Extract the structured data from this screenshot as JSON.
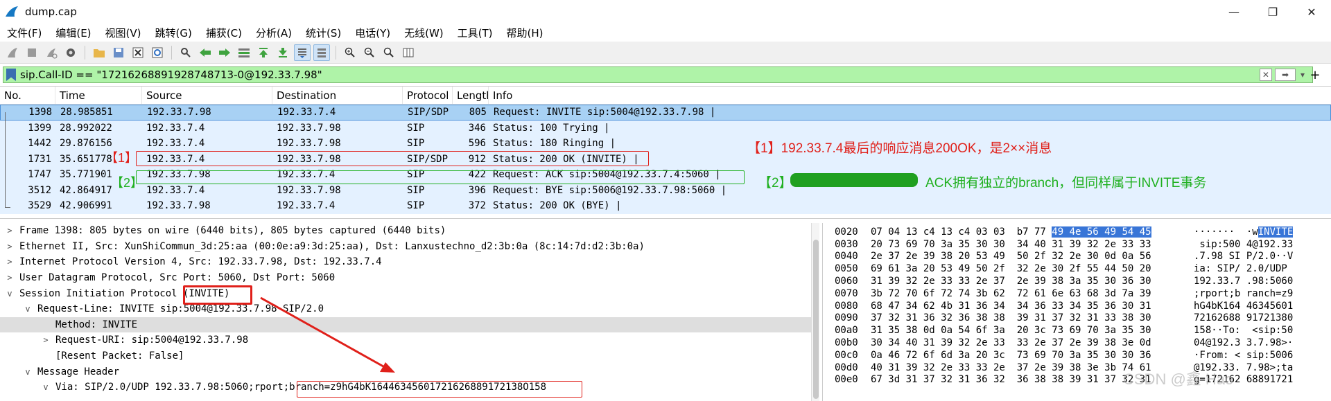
{
  "window": {
    "title": "dump.cap"
  },
  "menu": [
    "文件(F)",
    "编辑(E)",
    "视图(V)",
    "跳转(G)",
    "捕获(C)",
    "分析(A)",
    "统计(S)",
    "电话(Y)",
    "无线(W)",
    "工具(T)",
    "帮助(H)"
  ],
  "filter": {
    "value": "sip.Call-ID == \"17216268891928748713-0@192.33.7.98\""
  },
  "packet_list": {
    "columns": [
      "No.",
      "Time",
      "Source",
      "Destination",
      "Protocol",
      "Length",
      "Info"
    ],
    "rows": [
      {
        "no": "1398",
        "time": "28.985851",
        "src": "192.33.7.98",
        "dst": "192.33.7.4",
        "proto": "SIP/SDP",
        "len": "805",
        "info": "Request: INVITE sip:5004@192.33.7.98 |"
      },
      {
        "no": "1399",
        "time": "28.992022",
        "src": "192.33.7.4",
        "dst": "192.33.7.98",
        "proto": "SIP",
        "len": "346",
        "info": "Status: 100 Trying |"
      },
      {
        "no": "1442",
        "time": "29.876156",
        "src": "192.33.7.4",
        "dst": "192.33.7.98",
        "proto": "SIP",
        "len": "596",
        "info": "Status: 180 Ringing |"
      },
      {
        "no": "1731",
        "time": "35.651778",
        "src": "192.33.7.4",
        "dst": "192.33.7.98",
        "proto": "SIP/SDP",
        "len": "912",
        "info": "Status: 200 OK (INVITE) |"
      },
      {
        "no": "1747",
        "time": "35.771901",
        "src": "192.33.7.98",
        "dst": "192.33.7.4",
        "proto": "SIP",
        "len": "422",
        "info": "Request: ACK sip:5004@192.33.7.4:5060 |"
      },
      {
        "no": "3512",
        "time": "42.864917",
        "src": "192.33.7.4",
        "dst": "192.33.7.98",
        "proto": "SIP",
        "len": "396",
        "info": "Request: BYE sip:5006@192.33.7.98:5060 |"
      },
      {
        "no": "3529",
        "time": "42.906991",
        "src": "192.33.7.98",
        "dst": "192.33.7.4",
        "proto": "SIP",
        "len": "372",
        "info": "Status: 200 OK (BYE) |"
      }
    ]
  },
  "annotations": {
    "red_tag": "【1】",
    "red_note": "【1】192.33.7.4最后的响应消息200OK，是2××消息",
    "green_tag": "【2】",
    "green_note_prefix": "【2】",
    "green_note": "ACK拥有独立的branch，但同样属于INVITE事务"
  },
  "details": [
    {
      "arrow": ">",
      "indent": 0,
      "text": "Frame 1398: 805 bytes on wire (6440 bits), 805 bytes captured (6440 bits)"
    },
    {
      "arrow": ">",
      "indent": 0,
      "text": "Ethernet II, Src: XunShiCommun_3d:25:aa (00:0e:a9:3d:25:aa), Dst: Lanxustechno_d2:3b:0a (8c:14:7d:d2:3b:0a)"
    },
    {
      "arrow": ">",
      "indent": 0,
      "text": "Internet Protocol Version 4, Src: 192.33.7.98, Dst: 192.33.7.4"
    },
    {
      "arrow": ">",
      "indent": 0,
      "text": "User Datagram Protocol, Src Port: 5060, Dst Port: 5060"
    },
    {
      "arrow": "v",
      "indent": 0,
      "text": "Session Initiation Protocol (INVITE)"
    },
    {
      "arrow": "v",
      "indent": 1,
      "text": "Request-Line: INVITE sip:5004@192.33.7.98 SIP/2.0"
    },
    {
      "arrow": "",
      "indent": 2,
      "text": "Method: INVITE"
    },
    {
      "arrow": ">",
      "indent": 2,
      "text": "Request-URI: sip:5004@192.33.7.98"
    },
    {
      "arrow": "",
      "indent": 2,
      "text": "[Resent Packet: False]"
    },
    {
      "arrow": "v",
      "indent": 1,
      "text": "Message Header"
    },
    {
      "arrow": "v",
      "indent": 2,
      "text": "Via: SIP/2.0/UDP 192.33.7.98:5060;rport;branch=z9hG4bK16446345601721626889172138O158"
    }
  ],
  "bytes": [
    {
      "off": "0020",
      "hex": "07 04 13 c4 13 c4 03 03  b7 77 ",
      "hexhi": "49 4e 56 49 54 45",
      "asc": "·······  ·w",
      "aschi": "INVITE"
    },
    {
      "off": "0030",
      "hex": "20 73 69 70 3a 35 30 30  34 40 31 39 32 2e 33 33",
      "hexhi": "",
      "asc": " sip:500 4@192.33",
      "aschi": ""
    },
    {
      "off": "0040",
      "hex": "2e 37 2e 39 38 20 53 49  50 2f 32 2e 30 0d 0a 56",
      "hexhi": "",
      "asc": ".7.98 SI P/2.0··V",
      "aschi": ""
    },
    {
      "off": "0050",
      "hex": "69 61 3a 20 53 49 50 2f  32 2e 30 2f 55 44 50 20",
      "hexhi": "",
      "asc": "ia: SIP/ 2.0/UDP ",
      "aschi": ""
    },
    {
      "off": "0060",
      "hex": "31 39 32 2e 33 33 2e 37  2e 39 38 3a 35 30 36 30",
      "hexhi": "",
      "asc": "192.33.7 .98:5060",
      "aschi": ""
    },
    {
      "off": "0070",
      "hex": "3b 72 70 6f 72 74 3b 62  72 61 6e 63 68 3d 7a 39",
      "hexhi": "",
      "asc": ";rport;b ranch=z9",
      "aschi": ""
    },
    {
      "off": "0080",
      "hex": "68 47 34 62 4b 31 36 34  34 36 33 34 35 36 30 31",
      "hexhi": "",
      "asc": "hG4bK164 46345601",
      "aschi": ""
    },
    {
      "off": "0090",
      "hex": "37 32 31 36 32 36 38 38  39 31 37 32 31 33 38 30",
      "hexhi": "",
      "asc": "72162688 91721380",
      "aschi": ""
    },
    {
      "off": "00a0",
      "hex": "31 35 38 0d 0a 54 6f 3a  20 3c 73 69 70 3a 35 30",
      "hexhi": "",
      "asc": "158··To:  <sip:50",
      "aschi": ""
    },
    {
      "off": "00b0",
      "hex": "30 34 40 31 39 32 2e 33  33 2e 37 2e 39 38 3e 0d",
      "hexhi": "",
      "asc": "04@192.3 3.7.98>·",
      "aschi": ""
    },
    {
      "off": "00c0",
      "hex": "0a 46 72 6f 6d 3a 20 3c  73 69 70 3a 35 30 30 36",
      "hexhi": "",
      "asc": "·From: < sip:5006",
      "aschi": ""
    },
    {
      "off": "00d0",
      "hex": "40 31 39 32 2e 33 33 2e  37 2e 39 38 3e 3b 74 61",
      "hexhi": "",
      "asc": "@192.33. 7.98>;ta",
      "aschi": ""
    },
    {
      "off": "00e0",
      "hex": "67 3d 31 37 32 31 36 32  36 38 38 39 31 37 32 31",
      "hexhi": "",
      "asc": "g=172162 68891721",
      "aschi": ""
    }
  ],
  "watermark": "CSDN @鑫 Hao"
}
